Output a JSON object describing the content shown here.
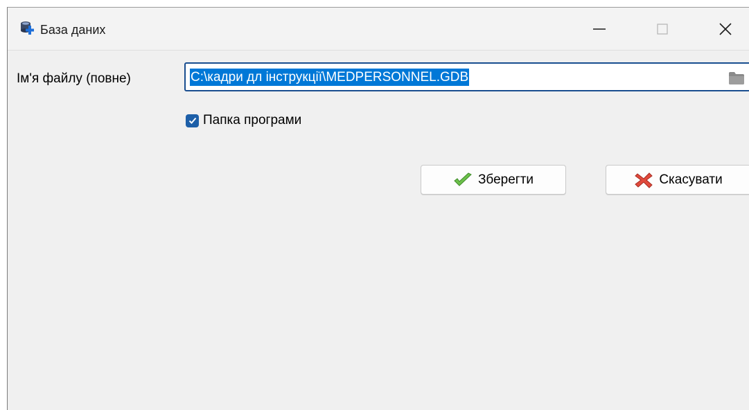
{
  "window": {
    "title": "База даних",
    "icon": "database-app-icon"
  },
  "controls": {
    "minimize_icon": "minimize-icon",
    "maximize_icon": "maximize-icon",
    "close_icon": "close-icon"
  },
  "form": {
    "file_label": "Ім'я файлу (повне)",
    "file_path": "C:\\кадри дл інструкції\\MEDPERSONNEL.GDB",
    "browse_icon": "folder-icon",
    "program_folder_label": "Папка програми",
    "program_folder_checked": true
  },
  "buttons": {
    "save_label": "Зберегти",
    "save_icon": "checkmark-icon",
    "cancel_label": "Скасувати",
    "cancel_icon": "cross-icon"
  },
  "colors": {
    "selection": "#0078d7",
    "input_border": "#184d8f",
    "checkbox": "#1d5fa8",
    "save_icon": "#6cc04a",
    "cancel_icon": "#e04a3c"
  }
}
